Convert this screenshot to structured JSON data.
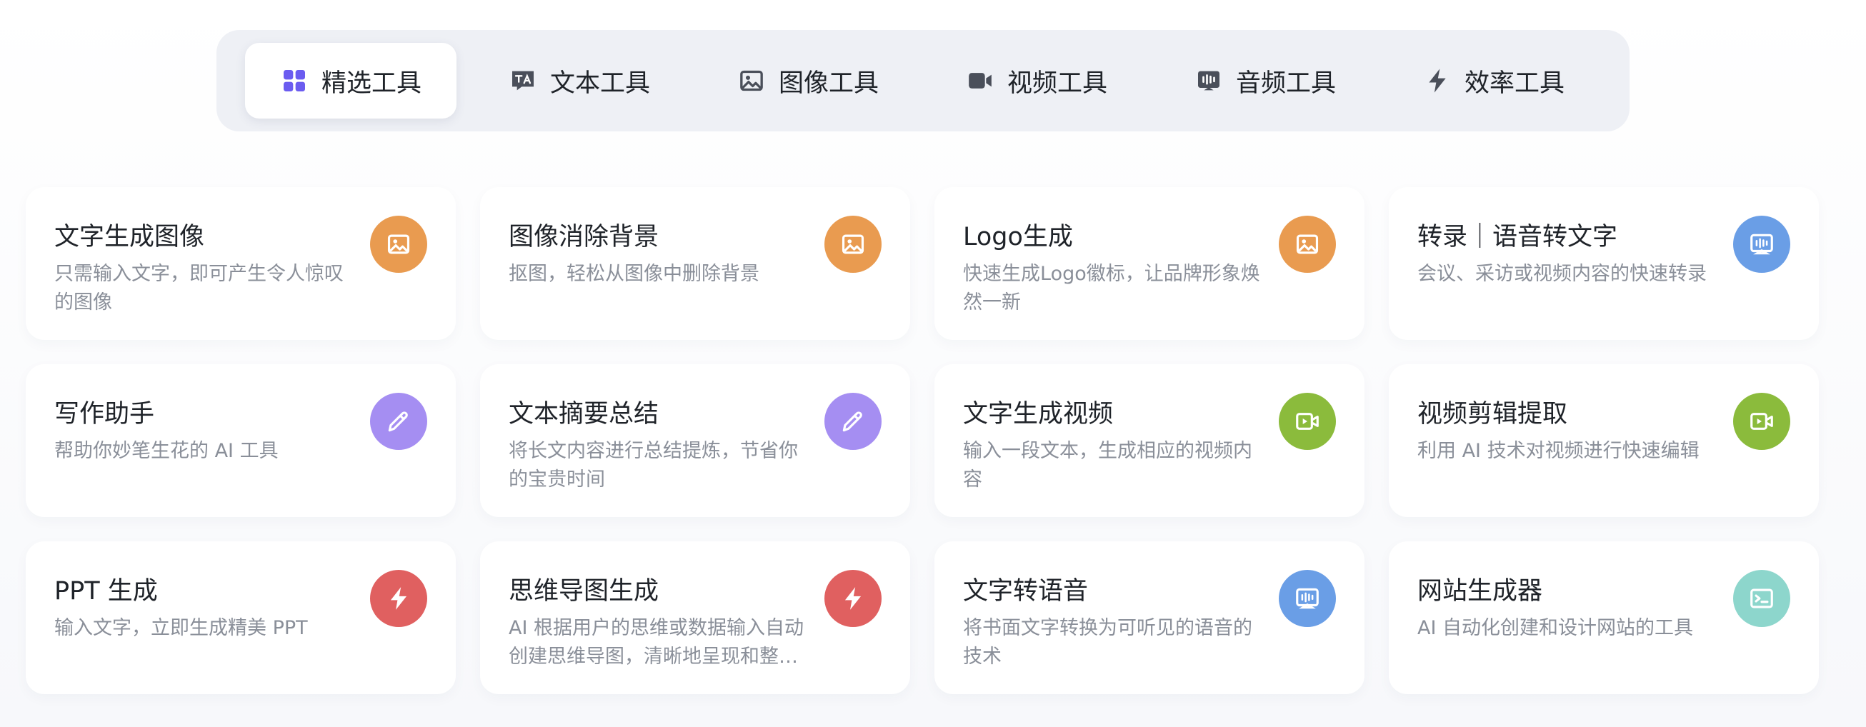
{
  "tabs": [
    {
      "label": "精选工具",
      "icon": "grid-icon",
      "active": true
    },
    {
      "label": "文本工具",
      "icon": "text-translate-icon",
      "active": false
    },
    {
      "label": "图像工具",
      "icon": "image-icon",
      "active": false
    },
    {
      "label": "视频工具",
      "icon": "video-camera-icon",
      "active": false
    },
    {
      "label": "音频工具",
      "icon": "audio-wave-icon",
      "active": false
    },
    {
      "label": "效率工具",
      "icon": "lightning-icon",
      "active": false
    }
  ],
  "colors": {
    "active_tab_icon": "#6b5cf0",
    "tab_icon": "#4a4f5a",
    "orange": "#e99b50",
    "blue": "#6a9ee6",
    "purple": "#a58ef2",
    "green": "#8bbb3c",
    "red": "#e06060",
    "teal": "#8dd6cc"
  },
  "cards": [
    {
      "title": "文字生成图像",
      "desc": "只需输入文字，即可产生令人惊叹的图像",
      "icon": "image-icon",
      "color": "orange"
    },
    {
      "title": "图像消除背景",
      "desc": "抠图，轻松从图像中删除背景",
      "icon": "image-icon",
      "color": "orange"
    },
    {
      "title": "Logo生成",
      "desc": "快速生成Logo徽标，让品牌形象焕然一新",
      "icon": "image-icon",
      "color": "orange"
    },
    {
      "title": "转录｜语音转文字",
      "desc": "会议、采访或视频内容的快速转录",
      "icon": "audio-wave-icon",
      "color": "blue"
    },
    {
      "title": "写作助手",
      "desc": "帮助你妙笔生花的 AI 工具",
      "icon": "pencil-icon",
      "color": "purple"
    },
    {
      "title": "文本摘要总结",
      "desc": "将长文内容进行总结提炼，节省你的宝贵时间",
      "icon": "pencil-icon",
      "color": "purple"
    },
    {
      "title": "文字生成视频",
      "desc": "输入一段文本，生成相应的视频内容",
      "icon": "video-icon",
      "color": "green"
    },
    {
      "title": "视频剪辑提取",
      "desc": "利用 AI 技术对视频进行快速编辑",
      "icon": "video-icon",
      "color": "green"
    },
    {
      "title": "PPT 生成",
      "desc": "输入文字，立即生成精美 PPT",
      "icon": "lightning-icon",
      "color": "red"
    },
    {
      "title": "思维导图生成",
      "desc": "AI 根据用户的思维或数据输入自动创建思维导图，清晰地呈现和整理信息",
      "icon": "lightning-icon",
      "color": "red"
    },
    {
      "title": "文字转语音",
      "desc": "将书面文字转换为可听见的语音的技术",
      "icon": "audio-wave-icon",
      "color": "blue"
    },
    {
      "title": "网站生成器",
      "desc": "AI 自动化创建和设计网站的工具",
      "icon": "terminal-icon",
      "color": "teal"
    }
  ]
}
